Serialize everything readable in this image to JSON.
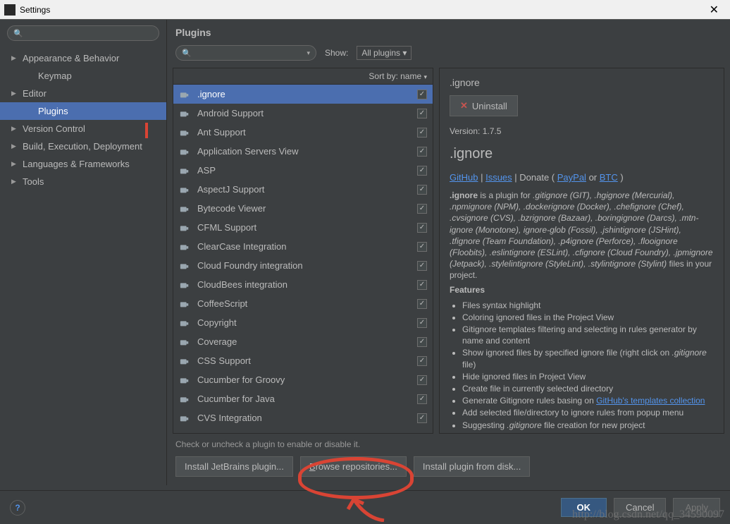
{
  "window": {
    "title": "Settings"
  },
  "sidebar": {
    "items": [
      {
        "label": "Appearance & Behavior",
        "arrow": true,
        "child": false
      },
      {
        "label": "Keymap",
        "arrow": false,
        "child": true
      },
      {
        "label": "Editor",
        "arrow": true,
        "child": false
      },
      {
        "label": "Plugins",
        "arrow": false,
        "child": true,
        "selected": true
      },
      {
        "label": "Version Control",
        "arrow": true,
        "child": false
      },
      {
        "label": "Build, Execution, Deployment",
        "arrow": true,
        "child": false
      },
      {
        "label": "Languages & Frameworks",
        "arrow": true,
        "child": false
      },
      {
        "label": "Tools",
        "arrow": true,
        "child": false
      }
    ]
  },
  "content": {
    "header": "Plugins",
    "show_label": "Show:",
    "show_value": "All plugins ▾",
    "sort_label": "Sort by: name",
    "hint": "Check or uncheck a plugin to enable or disable it.",
    "buttons": {
      "install_jetbrains": "Install JetBrains plugin...",
      "browse": "Browse repositories...",
      "install_disk": "Install plugin from disk..."
    }
  },
  "plugins": [
    {
      "name": ".ignore",
      "checked": true,
      "selected": true
    },
    {
      "name": "Android Support",
      "checked": true
    },
    {
      "name": "Ant Support",
      "checked": true
    },
    {
      "name": "Application Servers View",
      "checked": true
    },
    {
      "name": "ASP",
      "checked": true
    },
    {
      "name": "AspectJ Support",
      "checked": true
    },
    {
      "name": "Bytecode Viewer",
      "checked": true
    },
    {
      "name": "CFML Support",
      "checked": true
    },
    {
      "name": "ClearCase Integration",
      "checked": true
    },
    {
      "name": "Cloud Foundry integration",
      "checked": true
    },
    {
      "name": "CloudBees integration",
      "checked": true
    },
    {
      "name": "CoffeeScript",
      "checked": true
    },
    {
      "name": "Copyright",
      "checked": true
    },
    {
      "name": "Coverage",
      "checked": true
    },
    {
      "name": "CSS Support",
      "checked": true
    },
    {
      "name": "Cucumber for Groovy",
      "checked": true
    },
    {
      "name": "Cucumber for Java",
      "checked": true
    },
    {
      "name": "CVS Integration",
      "checked": true
    }
  ],
  "detail": {
    "name": ".ignore",
    "uninstall": "Uninstall",
    "version": "Version: 1.7.5",
    "title": ".ignore",
    "links": {
      "github": "GitHub",
      "issues": "Issues",
      "donate": "Donate",
      "paypal": "PayPal",
      "or": "or",
      "btc": "BTC"
    },
    "intro_prefix": ".ignore",
    "intro_mid": " is a plugin for ",
    "intro_formats": ".gitignore (GIT), .hgignore (Mercurial), .npmignore (NPM), .dockerignore (Docker), .chefignore (Chef), .cvsignore (CVS), .bzrignore (Bazaar), .boringignore (Darcs), .mtn-ignore (Monotone), ignore-glob (Fossil), .jshintignore (JSHint), .tfignore (Team Foundation), .p4ignore (Perforce), .flooignore (Floobits), .eslintignore (ESLint), .cfignore (Cloud Foundry), .jpmignore (Jetpack), .stylelintignore (StyleLint), .stylintignore (Stylint)",
    "intro_suffix": " files in your project.",
    "features_label": "Features",
    "features": [
      "Files syntax highlight",
      "Coloring ignored files in the Project View",
      "Gitignore templates filtering and selecting in rules generator by name and content",
      "Show ignored files by specified ignore file (right click on .gitignore file)",
      "Hide ignored files in Project View",
      "Create file in currently selected directory",
      "Generate Gitignore rules basing on GitHub's templates collection",
      "Add selected file/directory to ignore rules from popup menu",
      "Suggesting .gitignore file creation for new project"
    ],
    "feature_link": "GitHub's templates collection"
  },
  "footer": {
    "ok": "OK",
    "cancel": "Cancel",
    "apply": "Apply"
  },
  "watermark": "http://blog.csdn.net/qq_34590097"
}
